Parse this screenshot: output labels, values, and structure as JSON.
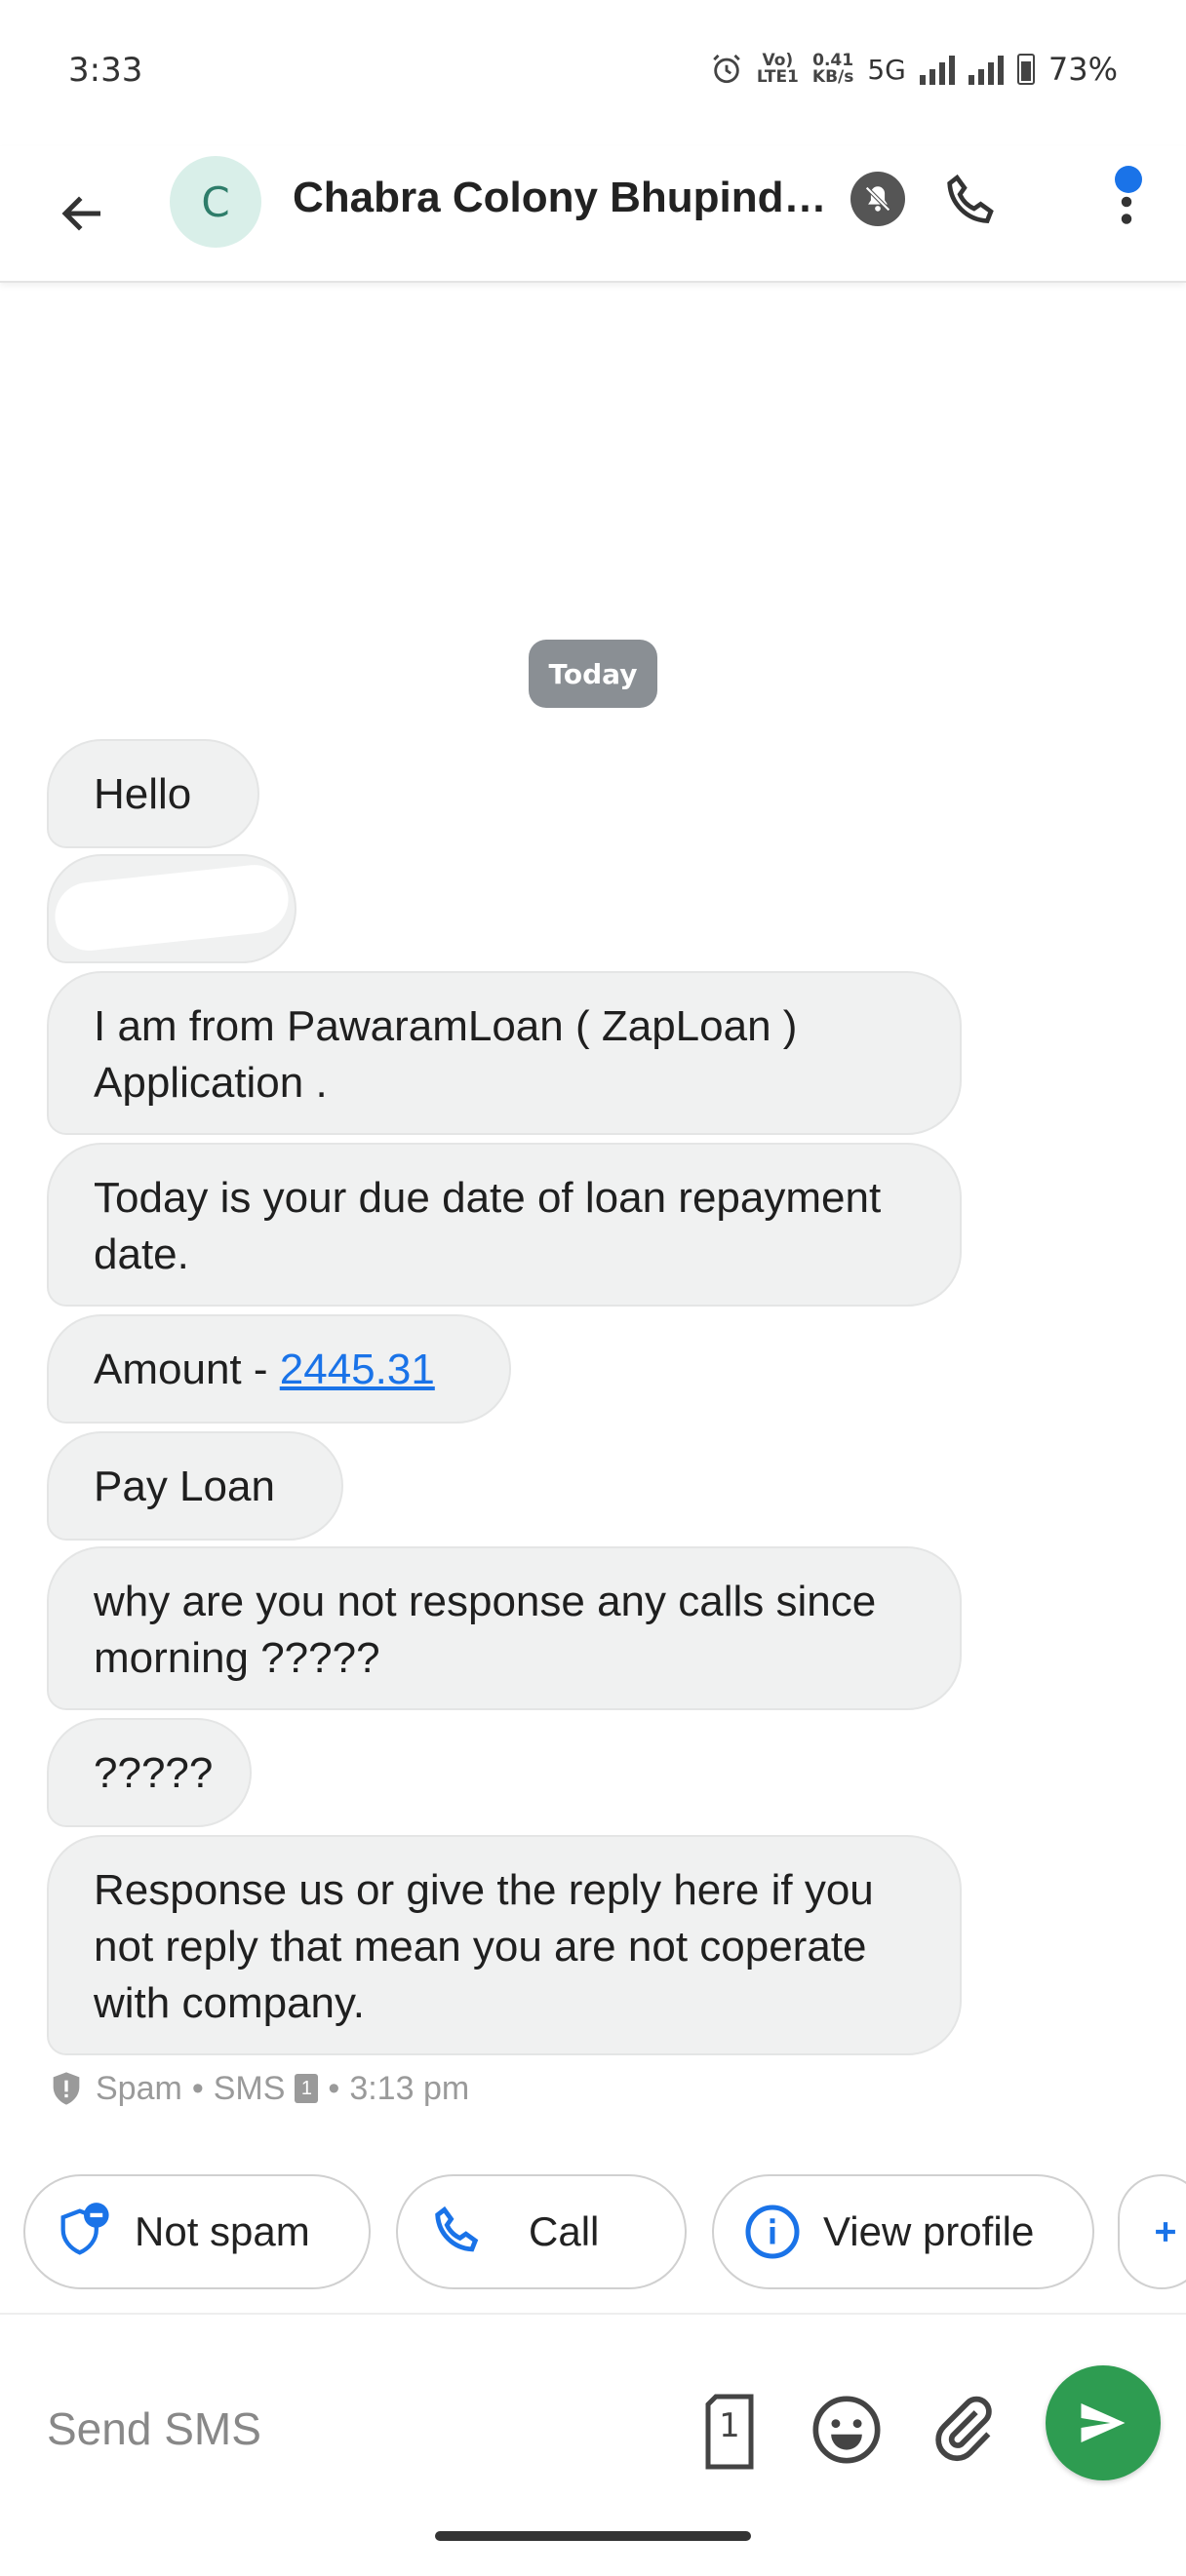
{
  "status_bar": {
    "time": "3:33",
    "volte": "Vo)\nLTE1",
    "speed": "0.41\nKB/s",
    "network": "5G",
    "battery": "73%"
  },
  "header": {
    "avatar_letter": "C",
    "contact_name": "Chabra Colony Bhupind…"
  },
  "conversation": {
    "date_chip": "Today",
    "messages": [
      "Hello",
      "",
      "I am from PawaramLoan ( ZapLoan  ) Application .",
      "Today is your due date of loan repayment date.",
      "Pay Loan",
      "why are you not response any calls since morning ?????",
      "?????",
      "Response us or give the reply here if you not reply that mean you are not coperate with company."
    ],
    "amount_prefix": "Amount - ",
    "amount_link": "2445.31",
    "meta": {
      "spam": "Spam",
      "sep1": "•",
      "channel": "SMS",
      "sim": "1",
      "sep2": "•",
      "time": "3:13 pm"
    }
  },
  "suggestions": {
    "not_spam": "Not spam",
    "call": "Call",
    "view_profile": "View profile"
  },
  "composer": {
    "placeholder": "Send SMS",
    "sim_number": "1"
  },
  "colors": {
    "accent_blue": "#1a73e8",
    "send_green": "#2e9c51",
    "bubble": "#f0f1f1"
  }
}
